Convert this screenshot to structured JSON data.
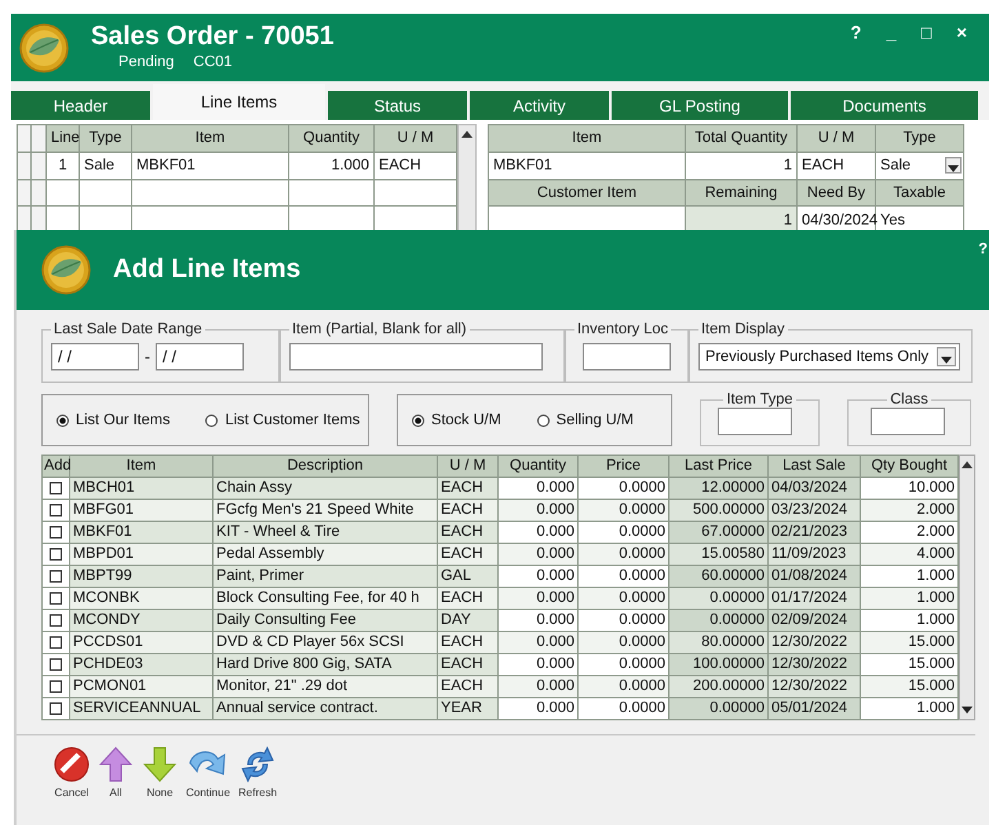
{
  "sales_order": {
    "title": "Sales Order - 70051",
    "status": "Pending",
    "code": "CC01",
    "window_controls": [
      "?",
      "_",
      "□",
      "×"
    ],
    "tabs": [
      {
        "label": "Header",
        "selected": false
      },
      {
        "label": "Line Items",
        "selected": true
      },
      {
        "label": "Status",
        "selected": false
      },
      {
        "label": "Activity",
        "selected": false
      },
      {
        "label": "GL Posting",
        "selected": false
      },
      {
        "label": "Documents",
        "selected": false
      }
    ],
    "lines_table": {
      "columns": [
        "Line",
        "Type",
        "Item",
        "Quantity",
        "U / M"
      ],
      "rows": [
        {
          "cells": [
            "1",
            "Sale",
            "MBKF01",
            "1.000",
            "EACH"
          ]
        }
      ]
    },
    "detail": {
      "header_1": [
        "Item",
        "Total Quantity",
        "U / M",
        "Type"
      ],
      "values_1": [
        "MBKF01",
        "1",
        "EACH",
        "Sale"
      ],
      "header_2": [
        "Customer Item",
        "Remaining",
        "Need By",
        "Taxable"
      ],
      "values_2": [
        "1",
        "04/30/2024",
        "Yes"
      ]
    }
  },
  "add_line_items": {
    "title": "Add Line Items",
    "help": "?",
    "filters": {
      "date_range": {
        "label": "Last Sale Date Range",
        "from": "/ /",
        "separator": "-",
        "to": "/ /"
      },
      "item": {
        "label": "Item (Partial, Blank for all)"
      },
      "inventory_loc": {
        "label": "Inventory Loc"
      },
      "item_display": {
        "label": "Item Display",
        "value": "Previously Purchased Items Only"
      }
    },
    "list_options": [
      {
        "label": "List Our Items",
        "selected": true
      },
      {
        "label": "List Customer Items",
        "selected": false
      }
    ],
    "um_options": [
      {
        "label": "Stock U/M",
        "selected": true
      },
      {
        "label": "Selling U/M",
        "selected": false
      }
    ],
    "item_type": {
      "label": "Item Type"
    },
    "class": {
      "label": "Class"
    },
    "table": {
      "columns": [
        "Add",
        "Item",
        "Description",
        "U / M",
        "Quantity",
        "Price",
        "Last Price",
        "Last Sale",
        "Qty Bought"
      ],
      "rows": [
        {
          "checked": false,
          "item": "MBCH01",
          "description": "Chain Assy",
          "um": "EACH",
          "quantity": "0.000",
          "price": "0.0000",
          "last_price": "12.00000",
          "last_sale": "04/03/2024",
          "qty_bought": "10.000"
        },
        {
          "checked": false,
          "item": "MBFG01",
          "description": "FGcfg Men's 21 Speed White",
          "um": "EACH",
          "quantity": "0.000",
          "price": "0.0000",
          "last_price": "500.00000",
          "last_sale": "03/23/2024",
          "qty_bought": "2.000"
        },
        {
          "checked": false,
          "item": "MBKF01",
          "description": "KIT - Wheel & Tire",
          "um": "EACH",
          "quantity": "0.000",
          "price": "0.0000",
          "last_price": "67.00000",
          "last_sale": "02/21/2023",
          "qty_bought": "2.000"
        },
        {
          "checked": false,
          "item": "MBPD01",
          "description": "Pedal Assembly",
          "um": "EACH",
          "quantity": "0.000",
          "price": "0.0000",
          "last_price": "15.00580",
          "last_sale": "11/09/2023",
          "qty_bought": "4.000"
        },
        {
          "checked": false,
          "item": "MBPT99",
          "description": "Paint, Primer",
          "um": "GAL",
          "quantity": "0.000",
          "price": "0.0000",
          "last_price": "60.00000",
          "last_sale": "01/08/2024",
          "qty_bought": "1.000"
        },
        {
          "checked": false,
          "item": "MCONBK",
          "description": "Block Consulting Fee, for 40 h",
          "um": "EACH",
          "quantity": "0.000",
          "price": "0.0000",
          "last_price": "0.00000",
          "last_sale": "01/17/2024",
          "qty_bought": "1.000"
        },
        {
          "checked": false,
          "item": "MCONDY",
          "description": "Daily Consulting Fee",
          "um": "DAY",
          "quantity": "0.000",
          "price": "0.0000",
          "last_price": "0.00000",
          "last_sale": "02/09/2024",
          "qty_bought": "1.000"
        },
        {
          "checked": false,
          "item": "PCCDS01",
          "description": "DVD & CD Player 56x SCSI",
          "um": "EACH",
          "quantity": "0.000",
          "price": "0.0000",
          "last_price": "80.00000",
          "last_sale": "12/30/2022",
          "qty_bought": "15.000"
        },
        {
          "checked": false,
          "item": "PCHDE03",
          "description": "Hard Drive 800 Gig, SATA",
          "um": "EACH",
          "quantity": "0.000",
          "price": "0.0000",
          "last_price": "100.00000",
          "last_sale": "12/30/2022",
          "qty_bought": "15.000"
        },
        {
          "checked": false,
          "item": "PCMON01",
          "description": "Monitor, 21\" .29 dot",
          "um": "EACH",
          "quantity": "0.000",
          "price": "0.0000",
          "last_price": "200.00000",
          "last_sale": "12/30/2022",
          "qty_bought": "15.000"
        },
        {
          "checked": false,
          "item": "SERVICEANNUAL",
          "description": "Annual service contract.",
          "um": "YEAR",
          "quantity": "0.000",
          "price": "0.0000",
          "last_price": "0.00000",
          "last_sale": "05/01/2024",
          "qty_bought": "1.000"
        }
      ]
    },
    "toolbar": [
      {
        "kind": "cancel",
        "label": "Cancel"
      },
      {
        "kind": "all",
        "label": "All"
      },
      {
        "kind": "none",
        "label": "None"
      },
      {
        "kind": "continue",
        "label": "Continue"
      },
      {
        "kind": "refresh",
        "label": "Refresh"
      }
    ]
  }
}
